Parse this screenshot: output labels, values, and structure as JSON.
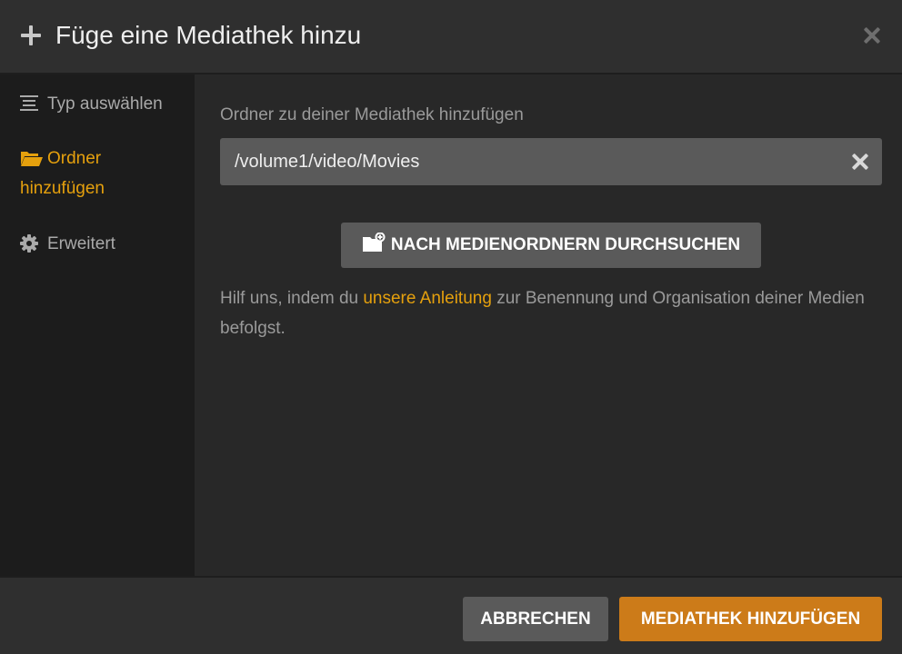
{
  "header": {
    "title": "Füge eine Mediathek hinzu",
    "plus_icon": "plus-icon",
    "close_icon": "close-icon"
  },
  "sidebar": {
    "items": [
      {
        "label": "Typ auswählen",
        "icon": "list-icon",
        "active": false
      },
      {
        "label": "Ordner hinzufügen",
        "icon": "folder-open-icon",
        "active": true
      },
      {
        "label": "Erweitert",
        "icon": "gear-icon",
        "active": false
      }
    ]
  },
  "main": {
    "label": "Ordner zu deiner Mediathek hinzufügen",
    "path_value": "/volume1/video/Movies",
    "browse_label": "NACH MEDIENORDNERN DURCHSUCHEN",
    "help_prefix": "Hilf uns, indem du ",
    "help_link": "unsere Anleitung",
    "help_suffix": " zur Benennung und Organisation deiner Medien befolgst."
  },
  "footer": {
    "cancel_label": "ABBRECHEN",
    "add_label": "MEDIATHEK HINZUFÜGEN"
  },
  "colors": {
    "accent": "#e5a00d",
    "primary_button": "#cc7b19",
    "secondary_button": "#5a5a5a"
  }
}
